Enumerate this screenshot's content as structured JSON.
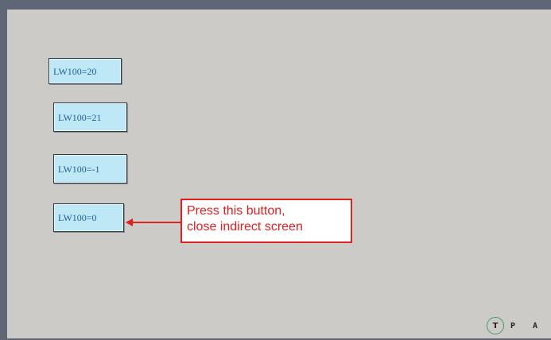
{
  "buttons": [
    {
      "label": "LW100=20"
    },
    {
      "label": "LW100=21"
    },
    {
      "label": "LW100=-1"
    },
    {
      "label": "LW100=0"
    }
  ],
  "callout": {
    "line1": "Press this button,",
    "line2": "close indirect screen"
  },
  "status": {
    "t": "T",
    "p": "P",
    "a": "A"
  },
  "colors": {
    "frame": "#5f6675",
    "screen_bg": "#cccbc8",
    "button_fill": "#bfe8f6",
    "button_text": "#1f5f9a",
    "callout_red": "#e02020"
  }
}
